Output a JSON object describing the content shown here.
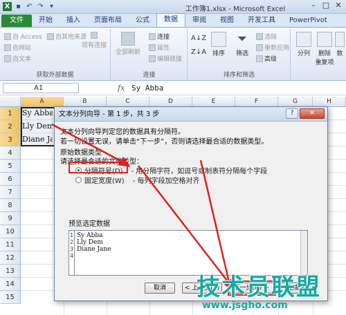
{
  "window": {
    "title": "工作簿1.xlsx - Microsoft Excel",
    "controls": [
      "–",
      "□",
      "✕"
    ],
    "qat_icons": [
      "excel-logo-icon",
      "save-icon",
      "undo-icon",
      "redo-icon",
      "customize-qat-icon"
    ]
  },
  "ribbon": {
    "tabs": [
      {
        "label": "文件"
      },
      {
        "label": "开始"
      },
      {
        "label": "插入"
      },
      {
        "label": "页面布局"
      },
      {
        "label": "公式"
      },
      {
        "label": "数据"
      },
      {
        "label": "审阅"
      },
      {
        "label": "视图"
      },
      {
        "label": "开发工具"
      },
      {
        "label": "PowerPivot"
      }
    ],
    "active_tab": "数据",
    "groups": {
      "external": {
        "label": "获取外部数据",
        "items": [
          "自 Access",
          "自网站",
          "自文本",
          "自其他来源",
          "现有连接"
        ]
      },
      "connections": {
        "label": "连接",
        "refresh": "全部刷新",
        "items": [
          "连接",
          "属性",
          "编辑链接"
        ]
      },
      "sort_filter": {
        "label": "排序和筛选",
        "sort": "排序",
        "filter": "筛选",
        "items": [
          "清除",
          "重新应用",
          "高级"
        ]
      },
      "data_tools": {
        "split": "分列",
        "remove": "删除",
        "remove2": "重复项",
        "more": "数"
      }
    }
  },
  "formula_bar": {
    "name_box": "A1",
    "fx": "fx",
    "value": "Sy Abba"
  },
  "sheet": {
    "columns": [
      "A",
      "B",
      "C",
      "D",
      "E",
      "F",
      "G",
      "H"
    ],
    "rows": [
      "1",
      "2",
      "3",
      "4",
      "5",
      "6",
      "7",
      "8",
      "9",
      "10",
      "11",
      "12",
      "13",
      "14",
      "15"
    ],
    "cells": [
      "Sy Abba",
      "Lly Dem",
      "Diane Ja"
    ]
  },
  "dialog": {
    "title": "文本分列向导 - 第 1 步，共 3 步",
    "help_btn": "?",
    "close_btn": "✕",
    "line1": "文本分列向导判定您的数据具有分隔符。",
    "line2": "若一切设置无误，请单击“下一步”，否则请选择最合适的数据类型。",
    "section_type": "原始数据类型",
    "section_choose": "请选择最合适的文件类型：",
    "opt_delimited": "分隔符号(D)",
    "opt_delimited_desc": "- 用分隔字符，如逗号或制表符分隔每个字段",
    "opt_fixed": "固定宽度(W)",
    "opt_fixed_desc": "- 每列字段加空格对齐",
    "preview_label": "预览选定数据",
    "preview_line_numbers": [
      "1",
      "2",
      "3",
      "4"
    ],
    "preview_lines": [
      "Sy Abba",
      "Lly Dem",
      "Diane Jane",
      ""
    ],
    "btn_cancel": "取消",
    "btn_back": "< 上一步(B)",
    "btn_next": "下一步(N) >",
    "btn_finish": "完成(F)"
  },
  "watermark": {
    "text": "技术员联盟",
    "url": "www.jsgho.com"
  },
  "colors": {
    "file_tab": "#2a8a3a",
    "highlight": "#e0201c",
    "watermark": "#16a9a3"
  }
}
